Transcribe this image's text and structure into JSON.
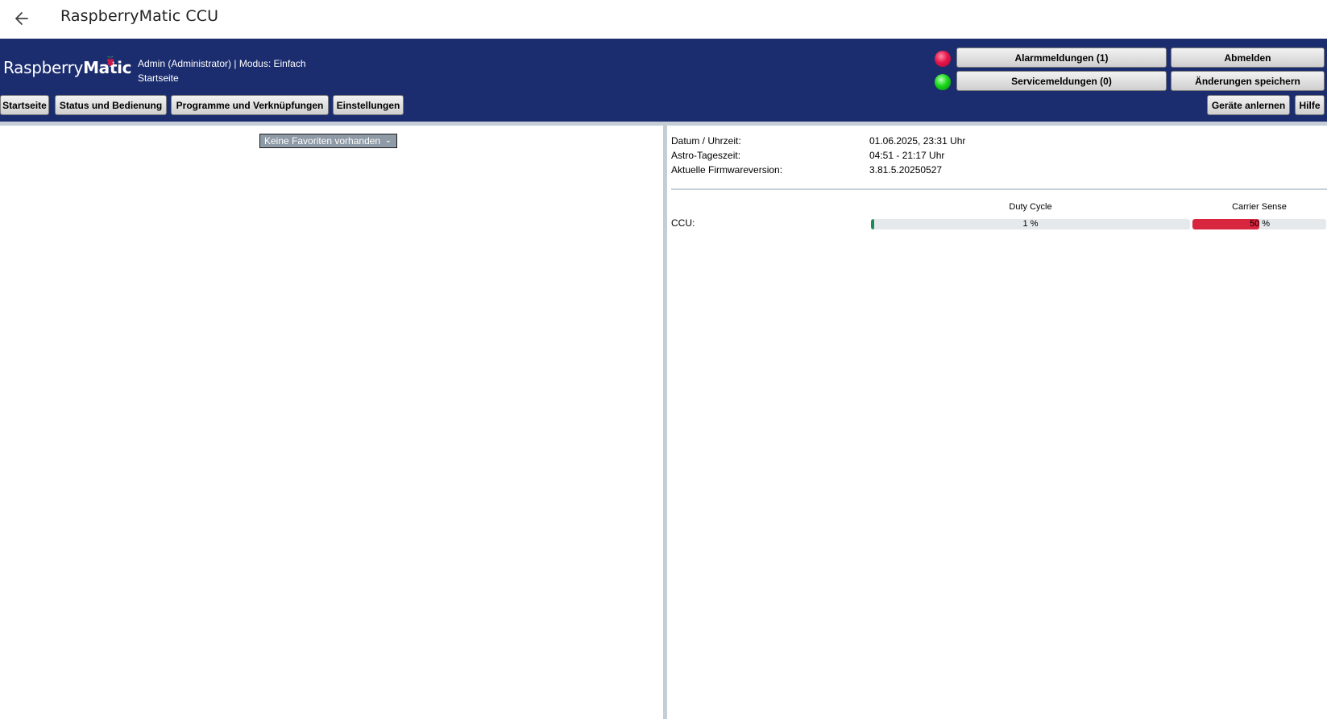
{
  "app": {
    "title": "RaspberryMatic CCU"
  },
  "header": {
    "logo_regular": "Raspberry",
    "logo_bold": "Matic",
    "user_line": "Admin (Administrator) | Modus: Einfach",
    "page_line": "Startseite",
    "alarm_button": "Alarmmeldungen (1)",
    "service_button": "Servicemeldungen (0)",
    "logout_button": "Abmelden",
    "save_button": "Änderungen speichern",
    "alarm_led_color": "#e8154a",
    "service_led_color": "#18d818",
    "nav": {
      "home": "Startseite",
      "status": "Status und Bedienung",
      "programs": "Programme und Verknüpfungen",
      "settings": "Einstellungen",
      "teach_in": "Geräte anlernen",
      "help": "Hilfe"
    }
  },
  "favorites": {
    "selected": "Keine Favoriten vorhanden"
  },
  "info": {
    "datetime_label": "Datum / Uhrzeit:",
    "datetime_value": "01.06.2025, 23:31 Uhr",
    "astro_label": "Astro-Tageszeit:",
    "astro_value": "04:51 - 21:17 Uhr",
    "firmware_label": "Aktuelle Firmwareversion:",
    "firmware_value": "3.81.5.20250527"
  },
  "radio": {
    "device_label": "CCU:",
    "duty_cycle_header": "Duty Cycle",
    "duty_cycle_value": 1,
    "duty_cycle_text": "1 %",
    "duty_cycle_color": "#1e8a5a",
    "carrier_sense_header": "Carrier Sense",
    "carrier_sense_value": 50,
    "carrier_sense_text_a": "50",
    "carrier_sense_text_b": " %",
    "carrier_sense_color": "#d7263d"
  },
  "colors": {
    "header_bg": "#1b2d6f",
    "separator": "#c5cdd6"
  }
}
